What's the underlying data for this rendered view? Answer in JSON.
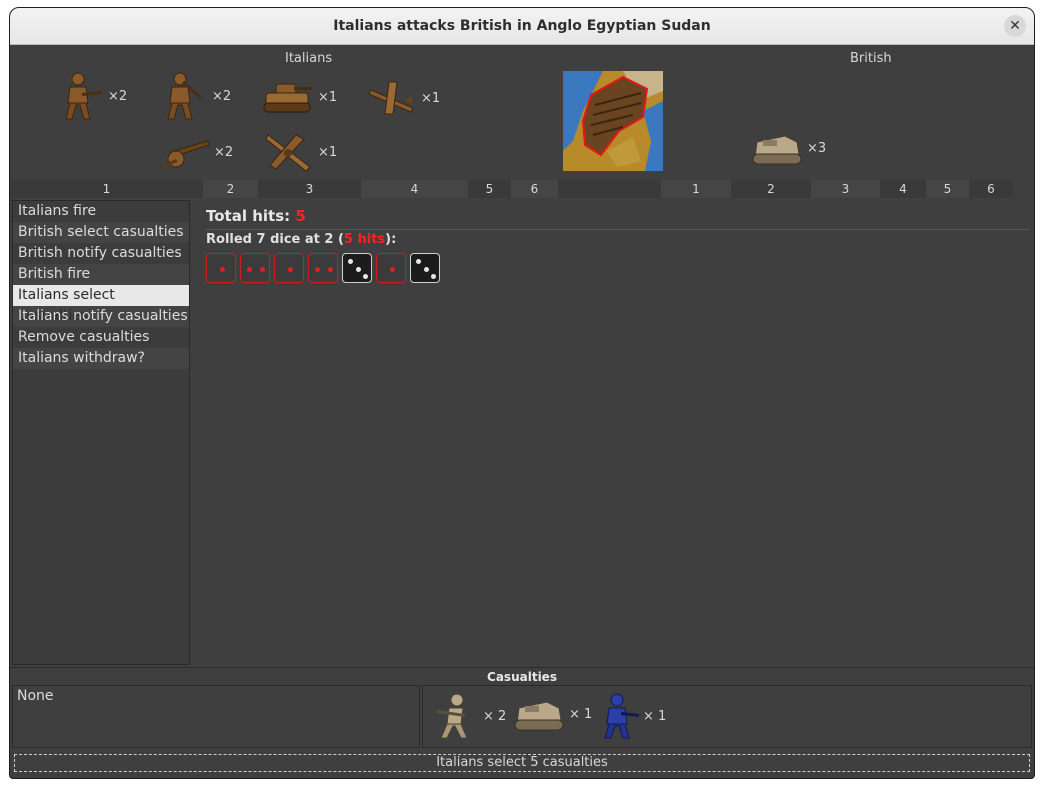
{
  "window": {
    "title": "Italians attacks British in Anglo Egyptian Sudan"
  },
  "attacker": {
    "name": "Italians",
    "units": [
      {
        "icon": "infantry-icon",
        "count": "×2"
      },
      {
        "icon": "infantry-icon",
        "count": "×2"
      },
      {
        "icon": "tank-icon",
        "count": "×1"
      },
      {
        "icon": "bomber-icon",
        "count": "×1"
      },
      {
        "icon": "artillery-icon",
        "count": "×2"
      },
      {
        "icon": "fighter-icon",
        "count": "×1"
      }
    ],
    "columns": [
      "1",
      "2",
      "3",
      "4",
      "5",
      "6"
    ]
  },
  "defender": {
    "name": "British",
    "units": [
      {
        "icon": "armored-car-icon",
        "count": "×3"
      }
    ],
    "columns": [
      "1",
      "2",
      "3",
      "4",
      "5",
      "6"
    ]
  },
  "territory": {
    "icon": "territory-map-icon"
  },
  "steps": [
    "Italians fire",
    "British select casualties",
    "British notify casualties",
    "British fire",
    "Italians select casualties",
    "Italians notify casualties",
    "Remove casualties",
    "Italians withdraw?"
  ],
  "selected_step": 4,
  "results": {
    "total_label": "Total hits: ",
    "total_value": "5",
    "rolled_prefix": "Rolled 7 dice at 2 (",
    "rolled_hits": "5 hits",
    "rolled_suffix": "):",
    "dice": [
      {
        "value": 1,
        "hit": true
      },
      {
        "value": 2,
        "hit": true
      },
      {
        "value": 1,
        "hit": true
      },
      {
        "value": 2,
        "hit": true
      },
      {
        "value": 3,
        "hit": false
      },
      {
        "value": 1,
        "hit": true
      },
      {
        "value": 3,
        "hit": false
      }
    ]
  },
  "casualties": {
    "header": "Casualties",
    "left_text": "None",
    "units": [
      {
        "icon": "british-infantry-icon",
        "count": "× 2"
      },
      {
        "icon": "armored-car-icon",
        "count": "× 1"
      },
      {
        "icon": "blue-infantry-icon",
        "count": "× 1"
      }
    ]
  },
  "status": "Italians select 5 casualties",
  "colors": {
    "hit_red": "#ff2020",
    "italian_unit": "#8a5a2a",
    "british_unit": "#b9a88a",
    "blue_unit": "#2c3ea8"
  }
}
